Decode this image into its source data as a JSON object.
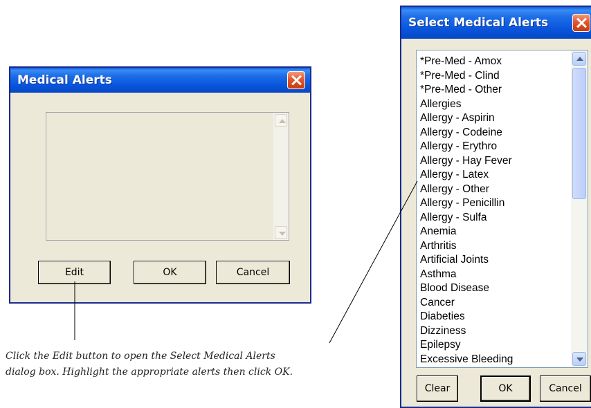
{
  "medical_alerts_dialog": {
    "title": "Medical Alerts",
    "buttons": {
      "edit": "Edit",
      "ok": "OK",
      "cancel": "Cancel"
    }
  },
  "select_dialog": {
    "title": "Select Medical Alerts",
    "items": [
      "*Pre-Med - Amox",
      "*Pre-Med - Clind",
      "*Pre-Med - Other",
      "Allergies",
      "Allergy - Aspirin",
      "Allergy - Codeine",
      "Allergy - Erythro",
      "Allergy - Hay Fever",
      "Allergy - Latex",
      "Allergy - Other",
      "Allergy - Penicillin",
      "Allergy - Sulfa",
      "Anemia",
      "Arthritis",
      "Artificial Joints",
      "Asthma",
      "Blood Disease",
      "Cancer",
      "Diabeties",
      "Dizziness",
      "Epilepsy",
      "Excessive Bleeding"
    ],
    "buttons": {
      "clear": "Clear",
      "ok": "OK",
      "cancel": "Cancel"
    }
  },
  "caption": {
    "line1": "Click the Edit button to open the Select Medical Alerts",
    "line2": "dialog box. Highlight the appropriate alerts then click OK."
  },
  "icons": {
    "close": "close-icon",
    "scroll_up": "chevron-up-icon",
    "scroll_down": "chevron-down-icon"
  }
}
